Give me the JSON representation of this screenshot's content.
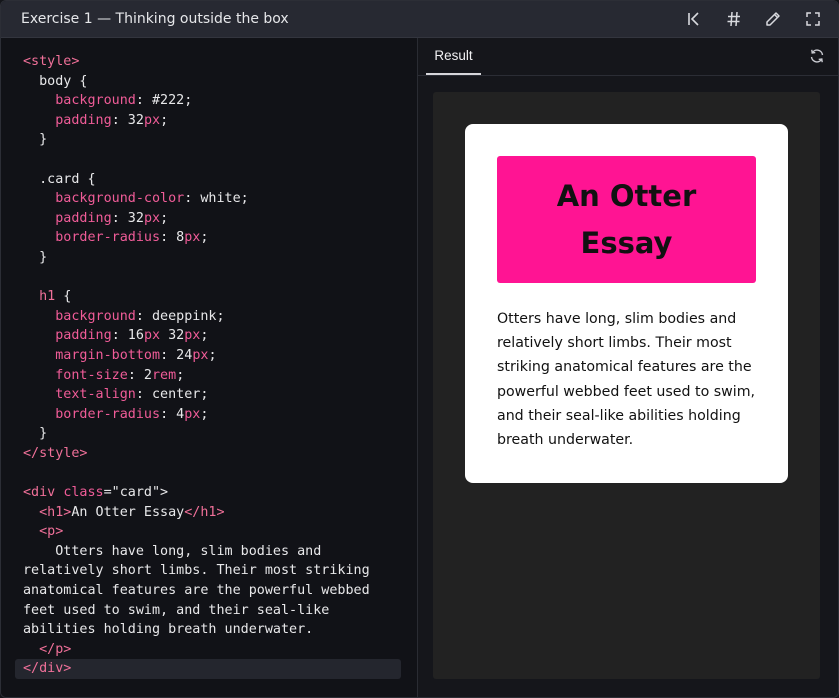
{
  "window": {
    "title": "Exercise 1 — Thinking outside the box"
  },
  "toolbar": [
    {
      "name": "reset-icon"
    },
    {
      "name": "hash-icon"
    },
    {
      "name": "pencil-icon"
    },
    {
      "name": "fullscreen-icon"
    }
  ],
  "colors": {
    "titlebar": "#272932",
    "editor_bg": "#111217",
    "keyword": "#f05c98",
    "preview_bg": "#222222",
    "heading_bg": "#ff1493"
  },
  "editor": {
    "lines": [
      [
        [
          "tag",
          "<style>"
        ]
      ],
      [
        [
          "plain",
          "  body {"
        ]
      ],
      [
        [
          "plain",
          "    "
        ],
        [
          "prop",
          "background"
        ],
        [
          "plain",
          ": #222;"
        ]
      ],
      [
        [
          "plain",
          "    "
        ],
        [
          "prop",
          "padding"
        ],
        [
          "plain",
          ": 32"
        ],
        [
          "unit",
          "px"
        ],
        [
          "plain",
          ";"
        ]
      ],
      [
        [
          "plain",
          "  }"
        ]
      ],
      [
        [
          "plain",
          ""
        ]
      ],
      [
        [
          "plain",
          "  .card {"
        ]
      ],
      [
        [
          "plain",
          "    "
        ],
        [
          "prop",
          "background-color"
        ],
        [
          "plain",
          ": white;"
        ]
      ],
      [
        [
          "plain",
          "    "
        ],
        [
          "prop",
          "padding"
        ],
        [
          "plain",
          ": 32"
        ],
        [
          "unit",
          "px"
        ],
        [
          "plain",
          ";"
        ]
      ],
      [
        [
          "plain",
          "    "
        ],
        [
          "prop",
          "border-radius"
        ],
        [
          "plain",
          ": 8"
        ],
        [
          "unit",
          "px"
        ],
        [
          "plain",
          ";"
        ]
      ],
      [
        [
          "plain",
          "  }"
        ]
      ],
      [
        [
          "plain",
          ""
        ]
      ],
      [
        [
          "plain",
          "  "
        ],
        [
          "tag",
          "h1"
        ],
        [
          "plain",
          " {"
        ]
      ],
      [
        [
          "plain",
          "    "
        ],
        [
          "prop",
          "background"
        ],
        [
          "plain",
          ": deeppink;"
        ]
      ],
      [
        [
          "plain",
          "    "
        ],
        [
          "prop",
          "padding"
        ],
        [
          "plain",
          ": 16"
        ],
        [
          "unit",
          "px"
        ],
        [
          "plain",
          " 32"
        ],
        [
          "unit",
          "px"
        ],
        [
          "plain",
          ";"
        ]
      ],
      [
        [
          "plain",
          "    "
        ],
        [
          "prop",
          "margin-bottom"
        ],
        [
          "plain",
          ": 24"
        ],
        [
          "unit",
          "px"
        ],
        [
          "plain",
          ";"
        ]
      ],
      [
        [
          "plain",
          "    "
        ],
        [
          "prop",
          "font-size"
        ],
        [
          "plain",
          ": 2"
        ],
        [
          "unit",
          "rem"
        ],
        [
          "plain",
          ";"
        ]
      ],
      [
        [
          "plain",
          "    "
        ],
        [
          "prop",
          "text-align"
        ],
        [
          "plain",
          ": center;"
        ]
      ],
      [
        [
          "plain",
          "    "
        ],
        [
          "prop",
          "border-radius"
        ],
        [
          "plain",
          ": 4"
        ],
        [
          "unit",
          "px"
        ],
        [
          "plain",
          ";"
        ]
      ],
      [
        [
          "plain",
          "  }"
        ]
      ],
      [
        [
          "tag",
          "</style>"
        ]
      ],
      [
        [
          "plain",
          ""
        ]
      ],
      [
        [
          "tag",
          "<div"
        ],
        [
          "plain",
          " "
        ],
        [
          "attr",
          "class"
        ],
        [
          "plain",
          "=\"card\">"
        ]
      ],
      [
        [
          "plain",
          "  "
        ],
        [
          "tag",
          "<h1>"
        ],
        [
          "plain",
          "An Otter Essay"
        ],
        [
          "tag",
          "</h1>"
        ]
      ],
      [
        [
          "plain",
          "  "
        ],
        [
          "tag",
          "<p>"
        ]
      ],
      [
        [
          "plain",
          "    Otters have long, slim bodies and"
        ]
      ],
      [
        [
          "plain",
          "relatively short limbs. Their most striking"
        ]
      ],
      [
        [
          "plain",
          "anatomical features are the powerful webbed"
        ]
      ],
      [
        [
          "plain",
          "feet used to swim, and their seal-like"
        ]
      ],
      [
        [
          "plain",
          "abilities holding breath underwater."
        ]
      ],
      [
        [
          "plain",
          "  "
        ],
        [
          "tag",
          "</p>"
        ]
      ],
      [
        [
          "tag",
          "</div>"
        ]
      ]
    ]
  },
  "result": {
    "tab_label": "Result",
    "refresh_icon": "refresh-icon",
    "heading_line1": "An Otter",
    "heading_line2": "Essay",
    "paragraph": "Otters have long, slim bodies and relatively short limbs. Their most striking anatomical features are the powerful webbed feet used to swim, and their seal-like abilities holding breath underwater."
  }
}
